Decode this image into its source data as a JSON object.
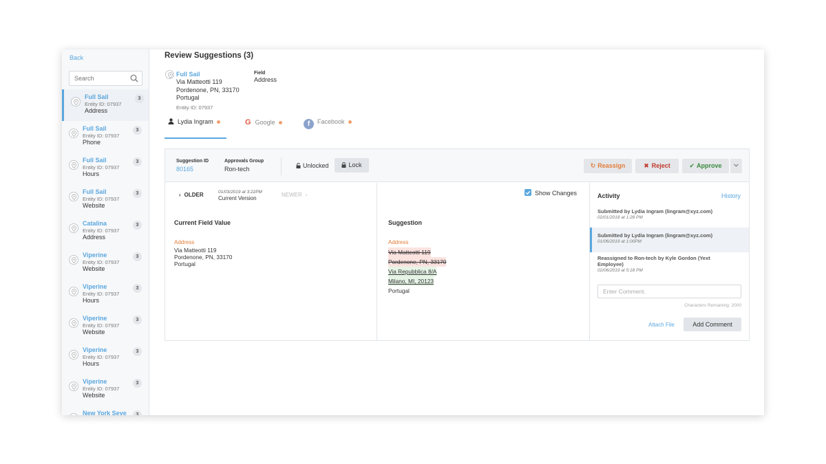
{
  "sidebar": {
    "back_label": "Back",
    "search_placeholder": "Search",
    "entities": [
      {
        "name": "Full Sail",
        "entity_id": "Entity ID:  07937",
        "field": "Address",
        "count": "3"
      },
      {
        "name": "Full Sail",
        "entity_id": "Entity ID:  07937",
        "field": "Phone",
        "count": "3"
      },
      {
        "name": "Full Sail",
        "entity_id": "Entity ID:  07937",
        "field": "Hours",
        "count": "3"
      },
      {
        "name": "Full Sail",
        "entity_id": "Entity ID:  07937",
        "field": "Website",
        "count": "3"
      },
      {
        "name": "Catalina",
        "entity_id": "Entity ID:  07937",
        "field": "Address",
        "count": "3"
      },
      {
        "name": "Viperine",
        "entity_id": "Entity ID:  07937",
        "field": "Website",
        "count": "3"
      },
      {
        "name": "Viperine",
        "entity_id": "Entity ID:  07937",
        "field": "Hours",
        "count": "3"
      },
      {
        "name": "Viperine",
        "entity_id": "Entity ID:  07937",
        "field": "Website",
        "count": "3"
      },
      {
        "name": "Viperine",
        "entity_id": "Entity ID:  07937",
        "field": "Hours",
        "count": "3"
      },
      {
        "name": "Viperine",
        "entity_id": "Entity ID:  07937",
        "field": "Website",
        "count": "3"
      },
      {
        "name": "New York Seve",
        "entity_id": "",
        "field": "",
        "count": "3"
      }
    ]
  },
  "header": {
    "title": "Review Suggestions (3)",
    "entity_name": "Full Sail",
    "address_lines": [
      "Via Matteotti 119",
      "Pordenone, PN, 33170",
      "Portugal"
    ],
    "entity_id": "Entity ID:  07937",
    "field_label": "Field",
    "field_value": "Address"
  },
  "tabs": [
    {
      "label": "Lydia Ingram"
    },
    {
      "label": "Google"
    },
    {
      "label": "Facebook"
    }
  ],
  "suggestion": {
    "id_label": "Suggestion ID",
    "id_value": "80165",
    "group_label": "Approvals Group",
    "group_value": "Ron-tech",
    "lock_status": "Unlocked",
    "lock_button": "Lock",
    "reassign_button": "Reassign",
    "reject_button": "Reject",
    "approve_button": "Approve"
  },
  "version": {
    "older_label": "OLDER",
    "date": "01/03/2019 at 3:22PM",
    "label": "Current Version",
    "newer_label": "NEWER"
  },
  "current": {
    "title": "Current Field Value",
    "address_label": "Address",
    "lines": [
      "Via Matteotti 119",
      "Pordenone, PN, 33170",
      "Portugal"
    ]
  },
  "proposed": {
    "title": "Suggestion",
    "address_label": "Address",
    "removed": [
      "Via Matteotti 119",
      "Pordenone, PN, 33170"
    ],
    "added": [
      "Via Repubblica 8/A",
      "Milano, MI, 20123"
    ],
    "unchanged": [
      "Portugal"
    ],
    "show_changes_label": "Show Changes"
  },
  "activity": {
    "title": "Activity",
    "history_label": "History",
    "items": [
      {
        "text": "Submitted by Lydia Ingram (lingram@xyz.com)",
        "date": "02/01/2018 at 1:28 PM"
      },
      {
        "text": "Submitted by Lydia Ingram (lingram@xyz.com)",
        "date": "01/06/2019 at 1:00PM"
      },
      {
        "text": "Reassigned to Ron-tech by Kyle Gordon (Yext Employee)",
        "date": "02/06/2019 at 5:18 PM"
      }
    ],
    "comment_placeholder": "Enter Comment.",
    "chars_remaining": "Characters Remaining: 2000",
    "attach_label": "Attach File",
    "add_comment_label": "Add Comment"
  },
  "colors": {
    "accent": "#5aa7de",
    "reassign": "#e27d3a",
    "reject": "#c0392b",
    "approve": "#3a8a3e",
    "facebook": "#8ba3cc"
  }
}
